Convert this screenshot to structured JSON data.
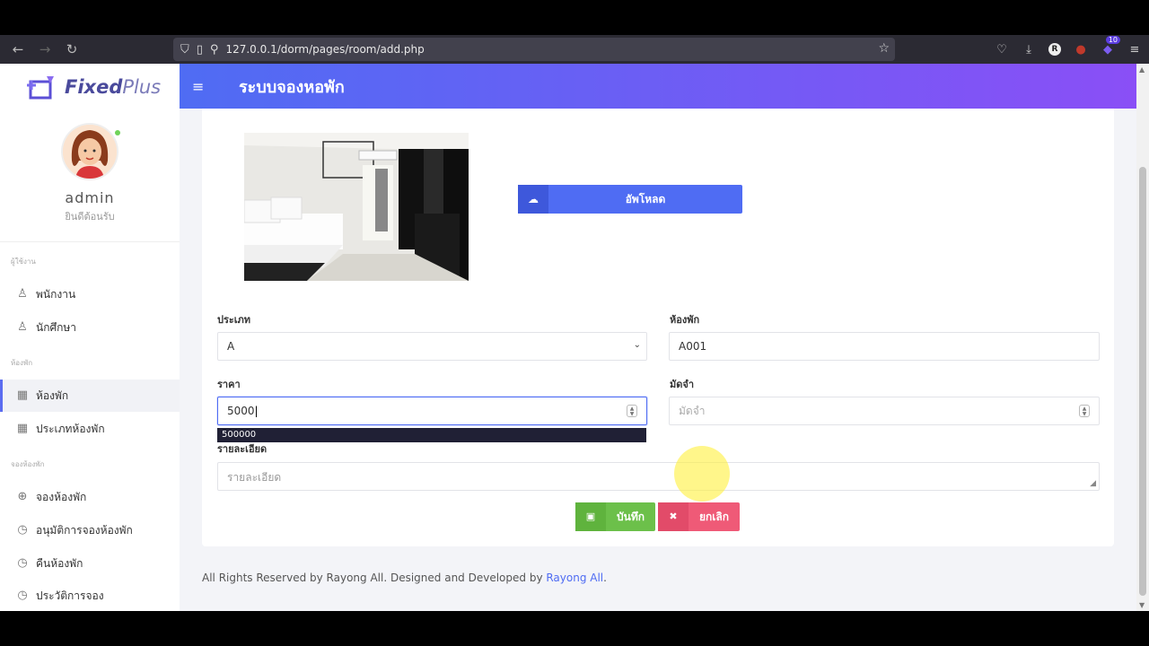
{
  "browser": {
    "url": "127.0.0.1/dorm/pages/room/add.php",
    "notification_count": "10",
    "profile_letter": "R"
  },
  "brand": {
    "name_bold": "Fixed",
    "name_light": "Plus"
  },
  "profile": {
    "name": "admin",
    "subtitle": "ยินดีต้อนรับ"
  },
  "sidebar": {
    "sections": [
      {
        "title": "ผู้ใช้งาน"
      },
      {
        "title": "ห้องพัก"
      },
      {
        "title": "จองห้องพัก"
      }
    ],
    "items": [
      {
        "label": "พนักงาน",
        "icon": "user-icon"
      },
      {
        "label": "นักศึกษา",
        "icon": "user-icon"
      },
      {
        "label": "ห้องพัก",
        "icon": "grid-icon",
        "active": true
      },
      {
        "label": "ประเภทห้องพัก",
        "icon": "grid-icon"
      },
      {
        "label": "จองห้องพัก",
        "icon": "plus-circle-icon"
      },
      {
        "label": "อนุมัติการจองห้องพัก",
        "icon": "clock-icon"
      },
      {
        "label": "คืนห้องพัก",
        "icon": "clock-icon"
      },
      {
        "label": "ประวัติการจอง",
        "icon": "clock-icon"
      }
    ]
  },
  "header": {
    "title": "ระบบจองหอพัก"
  },
  "form": {
    "upload_label": "อัพโหลด",
    "type_label": "ประเภท",
    "type_value": "A",
    "room_label": "ห้องพัก",
    "room_value": "A001",
    "price_label": "ราคา",
    "price_value": "5000",
    "price_suggestion": "500000",
    "deposit_label": "มัดจำ",
    "deposit_placeholder": "มัดจำ",
    "detail_label": "รายละเอียด",
    "detail_placeholder": "รายละเอียด",
    "save_label": "บันทึก",
    "cancel_label": "ยกเลิก"
  },
  "footer": {
    "text": "All Rights Reserved by Rayong All. Designed and Developed by ",
    "link": "Rayong All",
    "end": "."
  }
}
